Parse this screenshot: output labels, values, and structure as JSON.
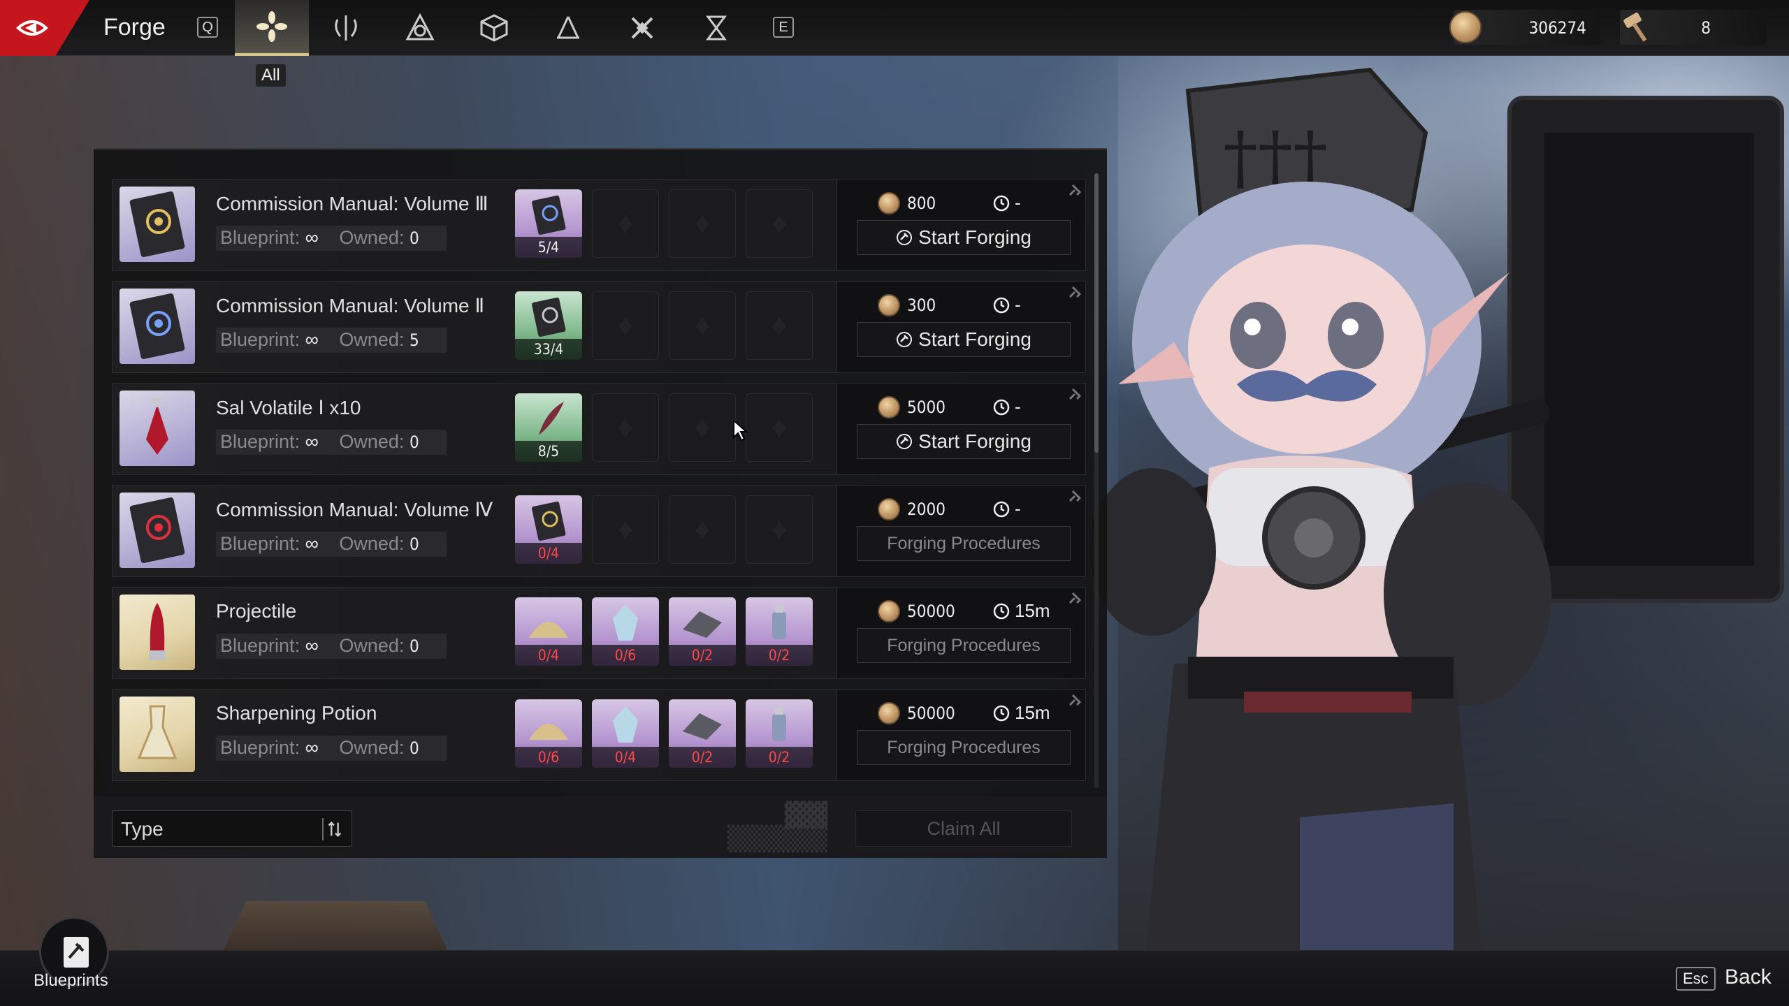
{
  "header": {
    "title": "Forge",
    "key_left": "Q",
    "key_right": "E",
    "active_tab_tooltip": "All",
    "tabs": [
      {
        "icon": "flower-icon",
        "active": true
      },
      {
        "icon": "shield-sword-icon",
        "active": false
      },
      {
        "icon": "triangle-knot-icon",
        "active": false
      },
      {
        "icon": "cube-icon",
        "active": false
      },
      {
        "icon": "compass-icon",
        "active": false
      },
      {
        "icon": "hammer-cross-icon",
        "active": false
      },
      {
        "icon": "hourglass-icon",
        "active": false
      }
    ],
    "currency": [
      {
        "icon": "coin-icon",
        "value": "306274"
      },
      {
        "icon": "hammer-icon",
        "value": "8"
      }
    ]
  },
  "recipes": [
    {
      "name": "Commission Manual: Volume Ⅲ",
      "blueprint_label": "Blueprint:",
      "blueprint_value": "∞",
      "owned_label": "Owned:",
      "owned_value": "0",
      "materials": [
        {
          "count": "5/4",
          "insufficient": false
        }
      ],
      "cost": "800",
      "time": "-",
      "action": "Start Forging",
      "action_enabled": true
    },
    {
      "name": "Commission Manual: Volume Ⅱ",
      "blueprint_label": "Blueprint:",
      "blueprint_value": "∞",
      "owned_label": "Owned:",
      "owned_value": "5",
      "materials": [
        {
          "count": "33/4",
          "insufficient": false
        }
      ],
      "cost": "300",
      "time": "-",
      "action": "Start Forging",
      "action_enabled": true
    },
    {
      "name": "Sal Volatile Ⅰ x10",
      "blueprint_label": "Blueprint:",
      "blueprint_value": "∞",
      "owned_label": "Owned:",
      "owned_value": "0",
      "materials": [
        {
          "count": "8/5",
          "insufficient": false
        }
      ],
      "cost": "5000",
      "time": "-",
      "action": "Start Forging",
      "action_enabled": true
    },
    {
      "name": "Commission Manual: Volume Ⅳ",
      "blueprint_label": "Blueprint:",
      "blueprint_value": "∞",
      "owned_label": "Owned:",
      "owned_value": "0",
      "materials": [
        {
          "count": "0/4",
          "insufficient": true
        }
      ],
      "cost": "2000",
      "time": "-",
      "action": "Forging Procedures",
      "action_enabled": false
    },
    {
      "name": "Projectile",
      "blueprint_label": "Blueprint:",
      "blueprint_value": "∞",
      "owned_label": "Owned:",
      "owned_value": "0",
      "materials": [
        {
          "count": "0/4",
          "insufficient": true
        },
        {
          "count": "0/6",
          "insufficient": true
        },
        {
          "count": "0/2",
          "insufficient": true
        },
        {
          "count": "0/2",
          "insufficient": true
        }
      ],
      "cost": "50000",
      "time": "15m",
      "action": "Forging Procedures",
      "action_enabled": false
    },
    {
      "name": "Sharpening Potion",
      "blueprint_label": "Blueprint:",
      "blueprint_value": "∞",
      "owned_label": "Owned:",
      "owned_value": "0",
      "materials": [
        {
          "count": "0/6",
          "insufficient": true
        },
        {
          "count": "0/4",
          "insufficient": true
        },
        {
          "count": "0/2",
          "insufficient": true
        },
        {
          "count": "0/2",
          "insufficient": true
        }
      ],
      "cost": "50000",
      "time": "15m",
      "action": "Forging Procedures",
      "action_enabled": false
    }
  ],
  "bottom": {
    "type_label": "Type",
    "claim_all": "Claim All"
  },
  "footer": {
    "blueprints_label": "Blueprints",
    "esc_key": "Esc",
    "back_label": "Back"
  },
  "colors": {
    "accent_red": "#c4161c",
    "insufficient": "#ff4a4a",
    "tab_active": "#d9c58a"
  }
}
